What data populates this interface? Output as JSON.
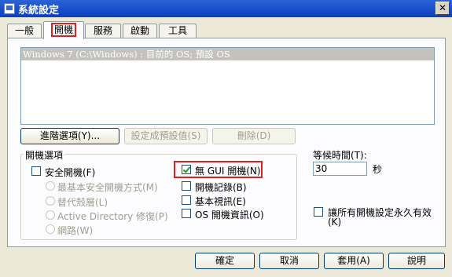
{
  "window": {
    "title": "系統設定",
    "close_symbol": "✕"
  },
  "tabs": [
    {
      "label": "一般"
    },
    {
      "label": "開機"
    },
    {
      "label": "服務"
    },
    {
      "label": "啟動"
    },
    {
      "label": "工具"
    }
  ],
  "boot": {
    "os_entry": "Windows 7 (C:\\Windows) : 目前的 OS; 預設 OS",
    "advanced_btn": "進階選項(Y)...",
    "set_default_btn": "設定成預設值(S)",
    "delete_btn": "刪除(D)",
    "options_group": "開機選項",
    "safe_boot": "安全開機(F)",
    "minimal": "最基本安全開機方式(M)",
    "alt_shell": "替代殼層(L)",
    "ad_repair": "Active Directory 修復(P)",
    "network": "網路(W)",
    "no_gui": "無 GUI 開機(N)",
    "boot_log": "開機記錄(B)",
    "base_video": "基本視訊(E)",
    "os_info": "OS 開機資訊(O)",
    "timeout_label": "等候時間(T):",
    "timeout_value": "30",
    "timeout_unit": "秒",
    "permanent_line1": "讓所有開機設定永久有效",
    "permanent_line2": "(K)"
  },
  "footer": {
    "ok": "確定",
    "cancel": "取消",
    "apply": "套用(A)",
    "help": "說明"
  },
  "colors": {
    "highlight": "#e02020",
    "title_bar": "#0a3fbf"
  }
}
